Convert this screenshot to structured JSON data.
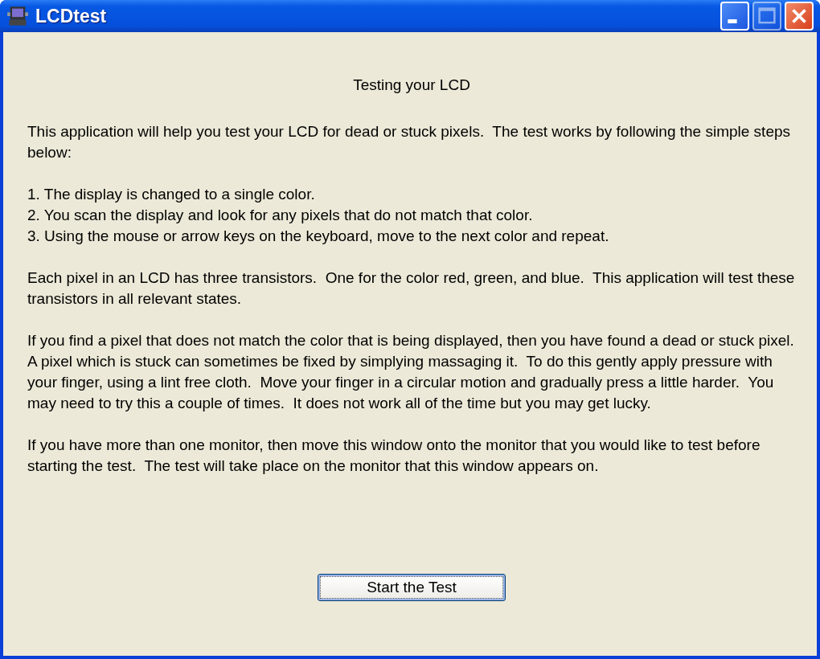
{
  "window": {
    "title": "LCDtest",
    "controls": [
      {
        "kind": "minimize",
        "disabled": false
      },
      {
        "kind": "maximize",
        "disabled": true
      },
      {
        "kind": "close",
        "disabled": false
      }
    ]
  },
  "heading": "Testing your LCD",
  "intro": "This application will help you test your LCD for dead or stuck pixels.  The test works by following the simple steps below:",
  "steps": [
    "1. The display is changed to a single color.",
    "2. You scan the display and look for any pixels that do not match that color.",
    "3. Using the mouse or arrow keys on the keyboard, move to the next color and repeat."
  ],
  "paragraphs": [
    "Each pixel in an LCD has three transistors.  One for the color red, green, and blue.  This application will test these transistors in all relevant states.",
    "If you find a pixel that does not match the color that is being displayed, then you have found a dead or stuck pixel.  A pixel which is stuck can sometimes be fixed by simplying massaging it.  To do this gently apply pressure with your finger, using a lint free cloth.  Move your finger in a circular motion and gradually press a little harder.  You may need to try this a couple of times.  It does not work all of the time but you may get lucky.",
    "If you have more than one monitor, then move this window onto the monitor that you would like to test before starting the test.  The test will take place on the monitor that this window appears on."
  ],
  "start_button": {
    "label": "Start the Test",
    "focused": true
  }
}
